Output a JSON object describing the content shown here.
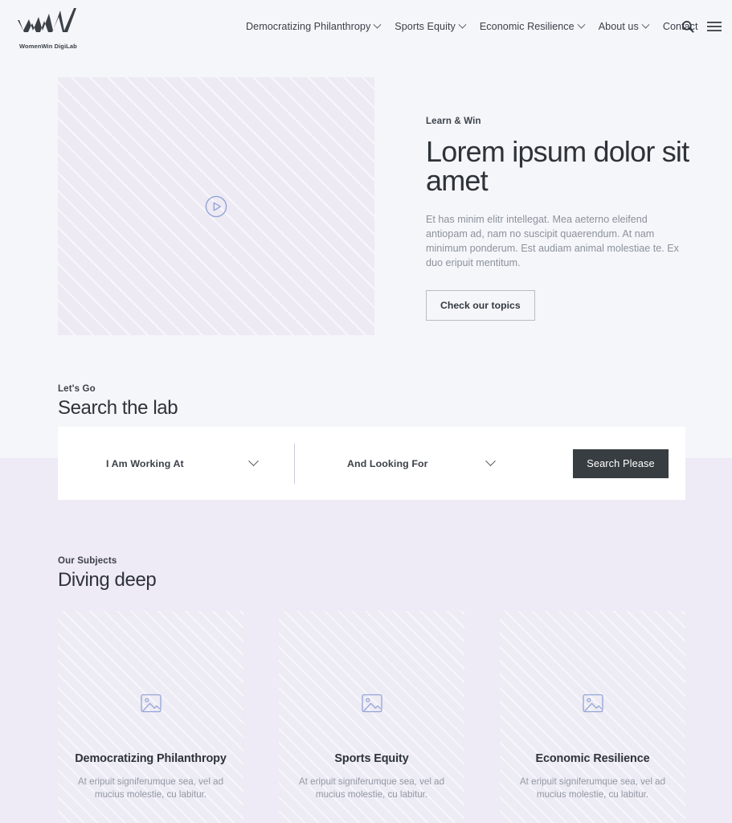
{
  "header": {
    "logo": {
      "mark_name": "womenwin-logo-mark",
      "caption": "WomenWin DigiLab"
    },
    "nav_items": [
      {
        "label": "Democratizing Philanthropy",
        "has_dropdown": true
      },
      {
        "label": "Sports Equity",
        "has_dropdown": true
      },
      {
        "label": "Economic Resilience",
        "has_dropdown": true
      },
      {
        "label": "About us",
        "has_dropdown": true
      },
      {
        "label": "Contact",
        "has_dropdown": false
      }
    ],
    "actions": [
      {
        "icon": "search-icon"
      },
      {
        "icon": "hamburger-menu-icon"
      }
    ]
  },
  "hero": {
    "media": {
      "icon": "play-circle-icon"
    },
    "eyebrow": "Learn & Win",
    "title": "Lorem ipsum dolor sit amet",
    "body": "Et has minim elitr intellegat. Mea aeterno eleifend antiopam ad, nam no suscipit quaerendum. At nam minimum ponderum. Est audiam animal molestiae te. Ex duo eripuit mentitum.",
    "cta_label": "Check our topics"
  },
  "search_section": {
    "eyebrow": "Let's Go",
    "title": "Search the lab",
    "field_one": {
      "value": "I Am Working At",
      "icon": "chevron-down-icon"
    },
    "field_two": {
      "value": "And Looking For",
      "icon": "chevron-down-icon"
    },
    "submit_label": "Search Please"
  },
  "subjects_section": {
    "eyebrow": "Our Subjects",
    "title": "Diving deep",
    "cards": [
      {
        "icon": "image-placeholder-icon",
        "title": "Democratizing Philanthropy",
        "description": "At eripuit signiferumque sea, vel ad mucius molestie, cu labitur."
      },
      {
        "icon": "image-placeholder-icon",
        "title": "Sports Equity",
        "description": "At eripuit signiferumque sea, vel ad mucius molestie, cu labitur."
      },
      {
        "icon": "image-placeholder-icon",
        "title": "Economic Resilience",
        "description": "At eripuit signiferumque sea, vel ad mucius molestie, cu labitur."
      }
    ]
  },
  "colors": {
    "band_top": "#f4f6fa",
    "band_bottom": "#eeeaf6",
    "panel": "#ffffff",
    "accent_dark": "#373d41",
    "text_primary": "#2e333a",
    "text_muted": "#8c919b",
    "placeholder_icon": "#93a4d8"
  }
}
